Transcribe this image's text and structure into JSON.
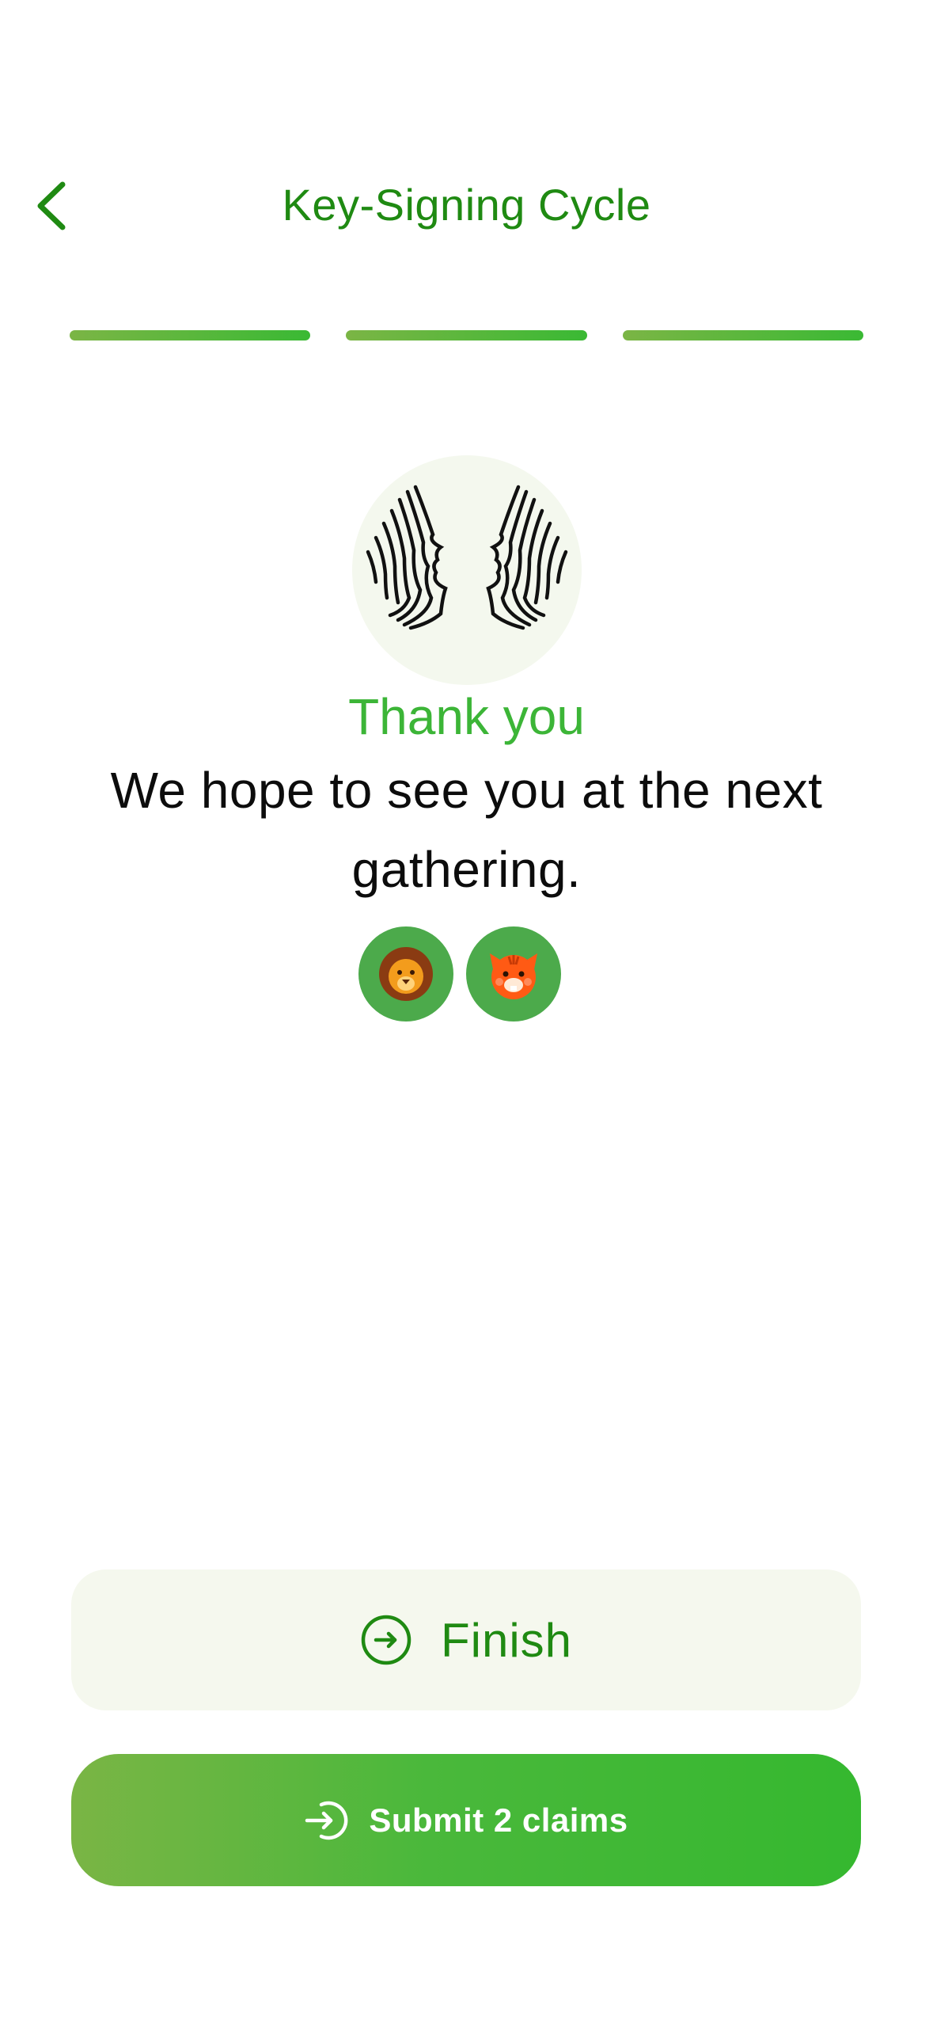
{
  "header": {
    "title": "Key-Signing Cycle",
    "back_icon": "chevron-left-icon"
  },
  "progress": {
    "steps_completed": 3,
    "steps_total": 3
  },
  "illustration": {
    "icon": "faces-profile-icon"
  },
  "main": {
    "title": "Thank you",
    "message": "We hope to see you at the next gathering."
  },
  "participants": [
    {
      "emoji": "🦁",
      "icon": "lion-avatar"
    },
    {
      "emoji": "🐯",
      "icon": "tiger-avatar"
    }
  ],
  "actions": {
    "finish_label": "Finish",
    "finish_icon": "arrow-right-circle-icon",
    "submit_label": "Submit 2 claims",
    "submit_icon": "login-arrow-icon"
  },
  "colors": {
    "brand_green": "#1f8a12",
    "accent_green": "#3cb537",
    "gradient_start": "#7ab545",
    "gradient_end": "#35b82f",
    "surface": "#f5f8ee"
  }
}
